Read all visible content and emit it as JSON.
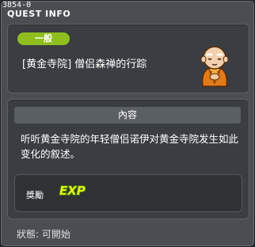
{
  "window": {
    "quest_id": "3854-0",
    "title": "QUEST INFO"
  },
  "quest": {
    "category": "一般",
    "name": "[黄金寺院] 僧侣森禅的行踪",
    "npc_icon": "monk-npc-icon"
  },
  "content": {
    "header": "內容",
    "text": "听听黄金寺院的年轻僧侣诺伊对黄金寺院发生如此变化的叙述。"
  },
  "reward": {
    "label": "獎勵",
    "exp_text": "EXP",
    "exp_icon": "exp-icon"
  },
  "status": {
    "text": "狀態: 可開始"
  },
  "colors": {
    "badge": "#8fbf1f",
    "exp": "#e3f21c"
  }
}
